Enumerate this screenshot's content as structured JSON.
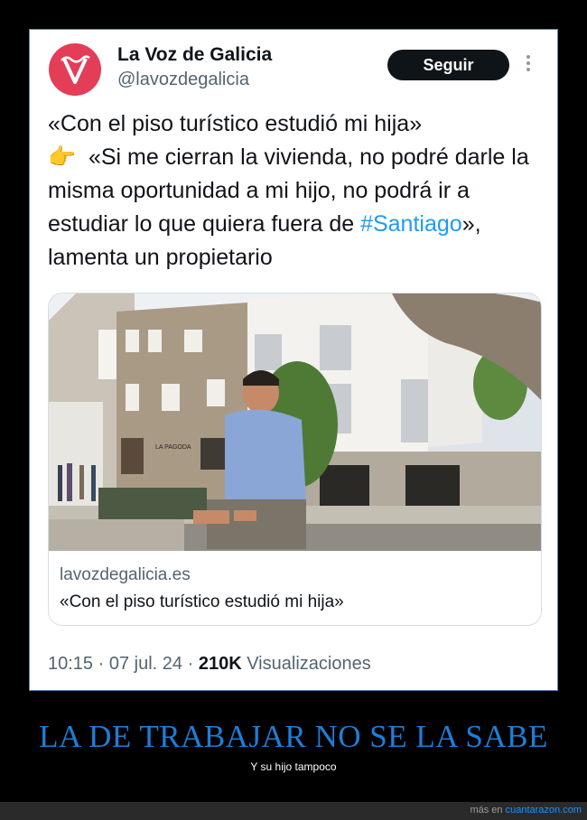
{
  "tweet": {
    "account_name": "La Voz de Galicia",
    "handle": "@lavozdegalicia",
    "follow_label": "Seguir",
    "text_line1": "«Con el piso turístico estudió mi hija»",
    "hand_emoji": "👉",
    "text_part2": "«Si me cierran la vivienda, no podré darle la misma oportunidad a mi hijo, no podrá ir a estudiar lo que quiera fuera de ",
    "hashtag": "#Santiago",
    "text_part3": "», lamenta un propietario",
    "link_card": {
      "domain": "lavozdegalicia.es",
      "title": "«Con el piso turístico estudió mi hija»"
    },
    "time": "10:15",
    "date": "07 jul. 24",
    "views_count": "210K",
    "views_label": "Visualizaciones",
    "separator": "·"
  },
  "caption": {
    "title": "LA DE TRABAJAR NO SE LA SABE",
    "subtitle": "Y su hijo tampoco"
  },
  "footer": {
    "prefix": "más en",
    "site": "cuantarazon.com"
  },
  "photo_sign": "LA PAGODA",
  "colors": {
    "avatar": "#e43d57",
    "hashtag": "#1d9bf0",
    "caption": "#1b7fd9",
    "follow_button": "#0f1419"
  }
}
